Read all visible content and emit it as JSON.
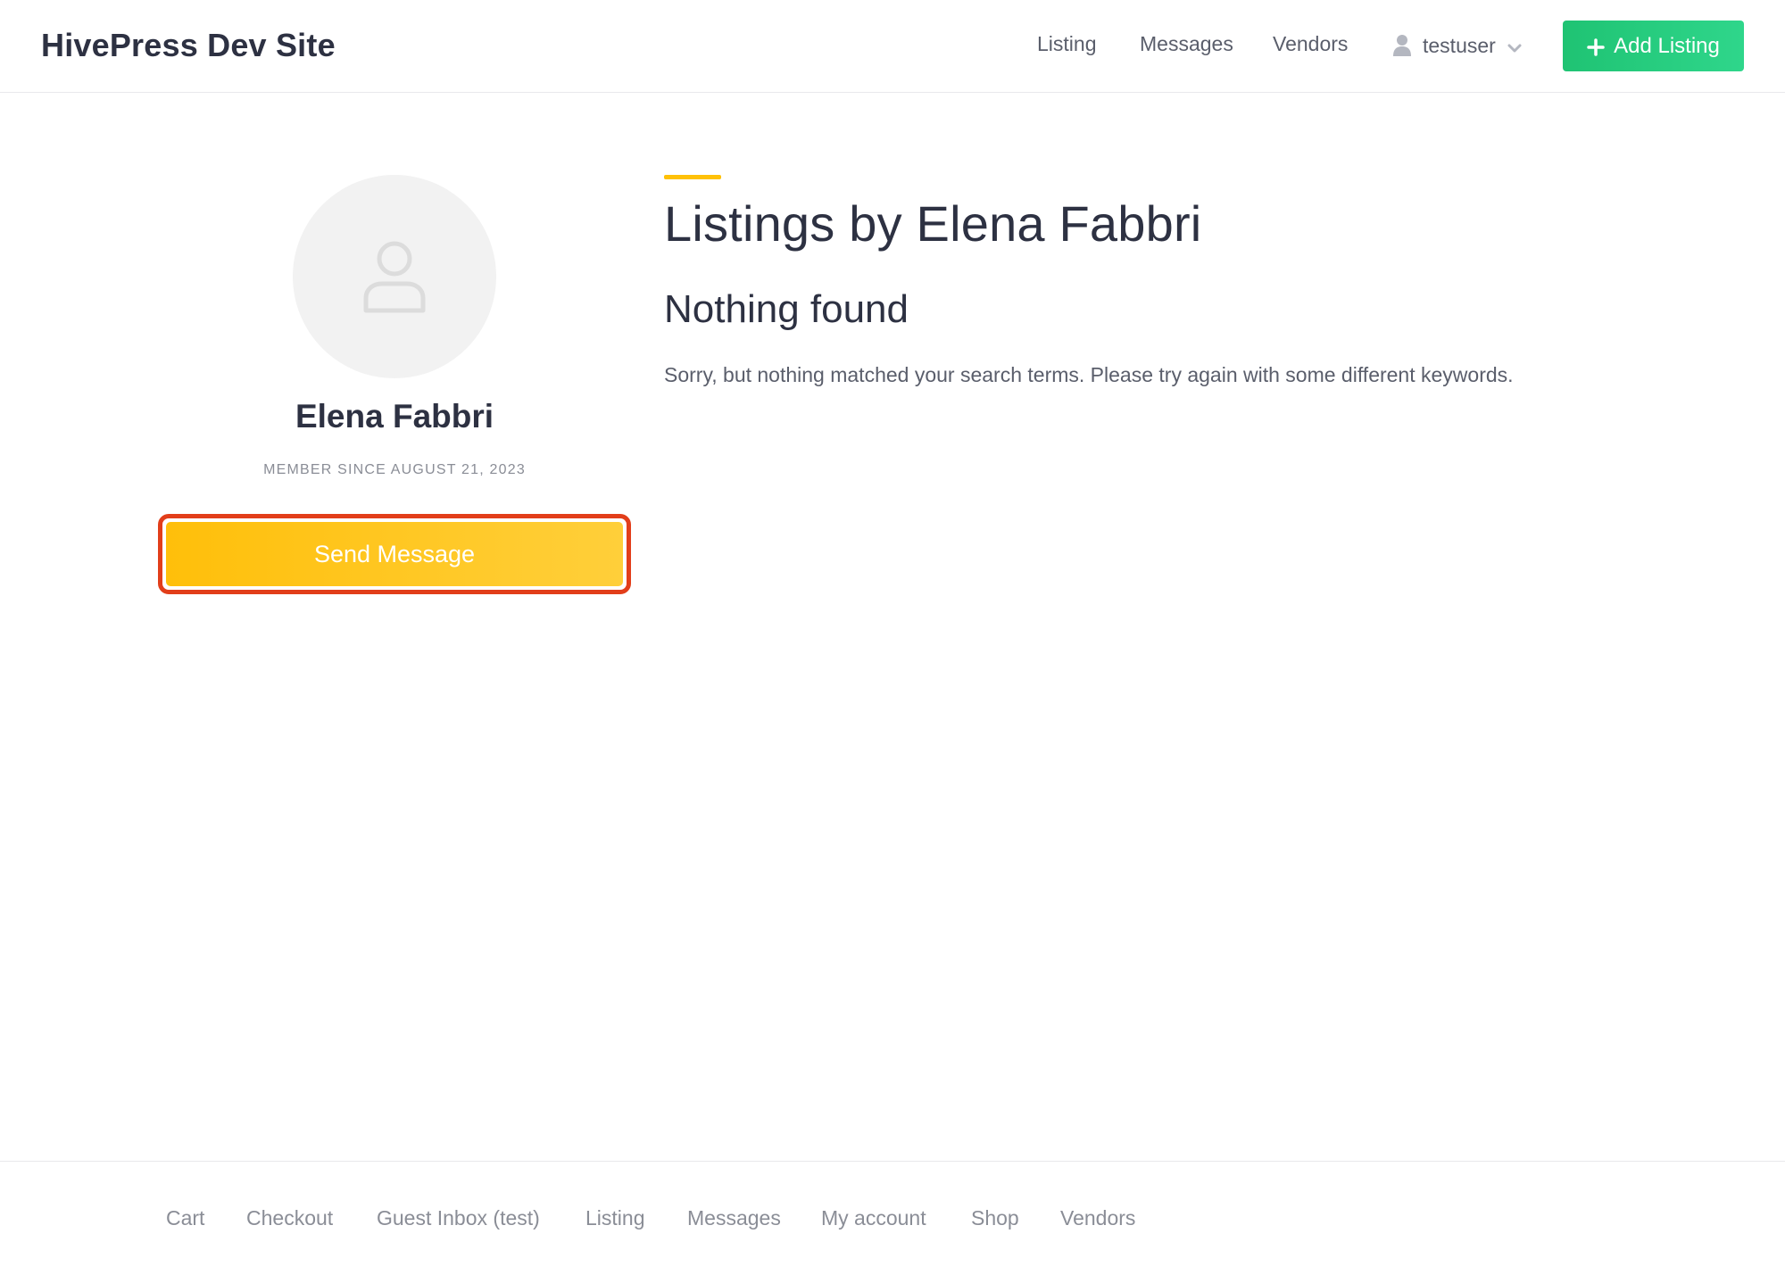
{
  "header": {
    "site_title": "HivePress Dev Site",
    "nav": [
      {
        "label": "Listing"
      },
      {
        "label": "Messages"
      },
      {
        "label": "Vendors"
      }
    ],
    "user_menu": {
      "username": "testuser",
      "icon": "user-icon",
      "dropdown_icon": "chevron-down-icon"
    },
    "add_listing_button": {
      "label": "Add Listing",
      "icon": "plus-icon"
    }
  },
  "profile": {
    "avatar_icon": "user-outline-icon",
    "name": "Elena Fabbri",
    "member_since": "MEMBER SINCE AUGUST 21, 2023",
    "send_message_label": "Send Message"
  },
  "main": {
    "title": "Listings by Elena Fabbri",
    "heading": "Nothing found",
    "message": "Sorry, but nothing matched your search terms. Please try again with some different keywords."
  },
  "footer": {
    "links": [
      {
        "label": "Cart"
      },
      {
        "label": "Checkout"
      },
      {
        "label": "Guest Inbox (test)"
      },
      {
        "label": "Listing"
      },
      {
        "label": "Messages"
      },
      {
        "label": "My account"
      },
      {
        "label": "Shop"
      },
      {
        "label": "Vendors"
      }
    ]
  },
  "colors": {
    "accent_yellow": "#ffc107",
    "green_button": "#1fc373",
    "highlight_outline": "#e23e1a",
    "text_dark": "#2d3142",
    "text_muted": "#8a8d96"
  }
}
